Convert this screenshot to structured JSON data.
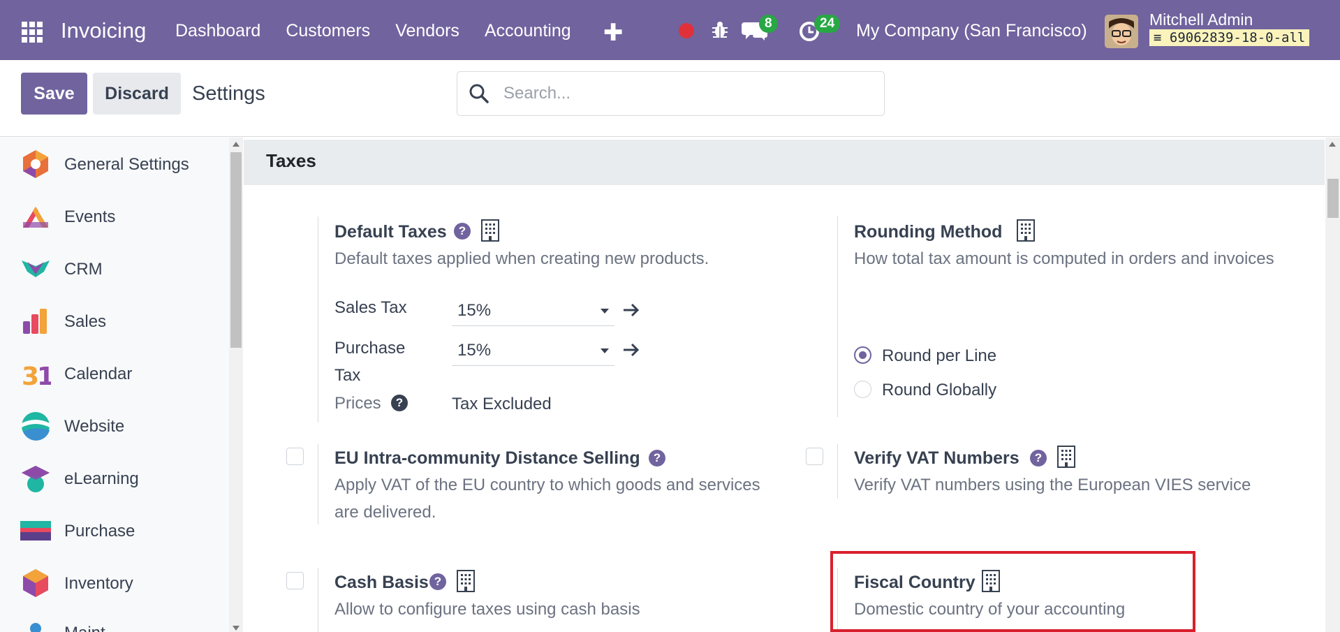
{
  "navbar": {
    "app_name": "Invoicing",
    "menu": [
      "Dashboard",
      "Customers",
      "Vendors",
      "Accounting"
    ],
    "messages_count": "8",
    "activities_count": "24",
    "company": "My Company (San Francisco)",
    "user_name": "Mitchell Admin",
    "database": "69062839-18-0-all",
    "bg_color": "#71639e"
  },
  "control": {
    "save_label": "Save",
    "discard_label": "Discard",
    "title": "Settings",
    "search_placeholder": "Search..."
  },
  "sidebar": {
    "items": [
      {
        "label": "General Settings",
        "icon": "general-settings-icon"
      },
      {
        "label": "Events",
        "icon": "events-icon"
      },
      {
        "label": "CRM",
        "icon": "crm-icon"
      },
      {
        "label": "Sales",
        "icon": "sales-icon"
      },
      {
        "label": "Calendar",
        "icon": "calendar-icon"
      },
      {
        "label": "Website",
        "icon": "website-icon"
      },
      {
        "label": "eLearning",
        "icon": "elearning-icon"
      },
      {
        "label": "Purchase",
        "icon": "purchase-icon"
      },
      {
        "label": "Inventory",
        "icon": "inventory-icon"
      },
      {
        "label": "Maint",
        "icon": "maintenance-icon"
      }
    ]
  },
  "section": {
    "title": "Taxes"
  },
  "default_taxes": {
    "title": "Default Taxes",
    "desc": "Default taxes applied when creating new products.",
    "sales_tax_label": "Sales Tax",
    "sales_tax_value": "15%",
    "purchase_tax_label": "Purchase Tax",
    "purchase_tax_value": "15%",
    "prices_label": "Prices",
    "prices_value": "Tax Excluded"
  },
  "rounding": {
    "title": "Rounding Method",
    "desc": "How total tax amount is computed in orders and invoices",
    "option_line": "Round per Line",
    "option_global": "Round Globally",
    "selected": "Round per Line"
  },
  "eu_distance": {
    "title": "EU Intra-community Distance Selling",
    "desc": "Apply VAT of the EU country to which goods and services are delivered."
  },
  "verify_vat": {
    "title": "Verify VAT Numbers",
    "desc": "Verify VAT numbers using the European VIES service"
  },
  "cash_basis": {
    "title": "Cash Basis",
    "desc": "Allow to configure taxes using cash basis"
  },
  "fiscal_country": {
    "title": "Fiscal Country",
    "desc": "Domestic country of your accounting"
  }
}
